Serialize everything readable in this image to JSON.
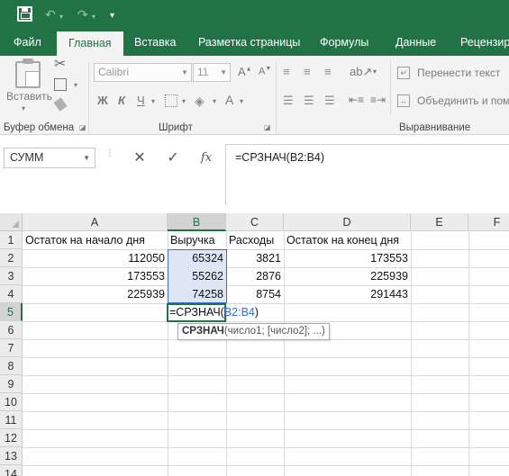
{
  "quick_access": {
    "save_icon": "save-icon",
    "undo_icon": "undo-icon",
    "redo_icon": "redo-icon",
    "customize_icon": "customize-icon"
  },
  "tabs": [
    {
      "label": "Файл",
      "active": false
    },
    {
      "label": "Главная",
      "active": true
    },
    {
      "label": "Вставка",
      "active": false
    },
    {
      "label": "Разметка страницы",
      "active": false
    },
    {
      "label": "Формулы",
      "active": false
    },
    {
      "label": "Данные",
      "active": false
    },
    {
      "label": "Рецензиро",
      "active": false
    }
  ],
  "ribbon": {
    "clipboard": {
      "paste_label": "Вставить",
      "group_label": "Буфер обмена"
    },
    "font": {
      "font_name": "Calibri",
      "font_size": "11",
      "bold": "Ж",
      "italic": "К",
      "underline": "Ч",
      "group_label": "Шрифт"
    },
    "alignment": {
      "wrap_text": "Перенести текст",
      "merge_center": "Объединить и пом",
      "group_label": "Выравнивание"
    }
  },
  "formula_bar": {
    "name_box": "СУММ",
    "cancel_icon": "cancel-icon",
    "enter_icon": "enter-icon",
    "fx_label": "fx",
    "formula": "=СРЗНАЧ(B2:B4)"
  },
  "sheet": {
    "columns": [
      "A",
      "B",
      "C",
      "D",
      "E",
      "F"
    ],
    "rows": [
      "1",
      "2",
      "3",
      "4",
      "5",
      "6",
      "7",
      "8",
      "9",
      "10",
      "11",
      "12",
      "13",
      "14"
    ],
    "cells": {
      "A1": "Остаток на начало дня",
      "B1": "Выручка",
      "C1": "Расходы",
      "D1": "Остаток на конец дня",
      "A2": "112050",
      "B2": "65324",
      "C2": "3821",
      "D2": "173553",
      "A3": "173553",
      "B3": "55262",
      "C3": "2876",
      "D3": "225939",
      "A4": "225939",
      "B4": "74258",
      "C4": "8754",
      "D4": "291443"
    },
    "editing": {
      "prefix": "=СРЗНАЧ(",
      "ref": "B2:B4",
      "suffix": ")"
    },
    "tooltip": {
      "func": "СРЗНАЧ",
      "args": "(число1; [число2]; ...)"
    }
  },
  "colors": {
    "accent": "#217346",
    "selection": "#3a6fc4"
  }
}
